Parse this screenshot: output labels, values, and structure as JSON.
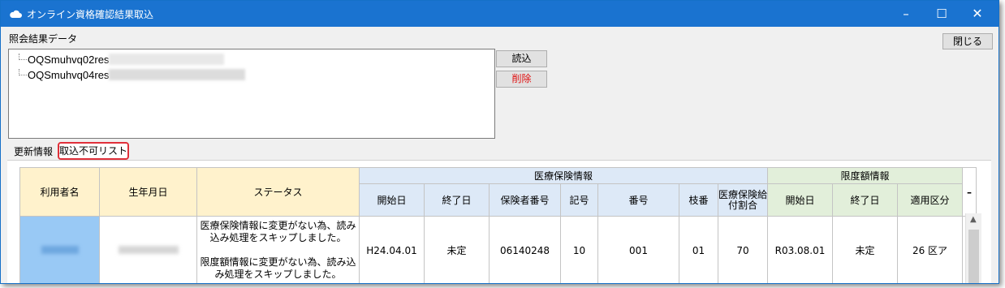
{
  "window": {
    "title": "オンライン資格確認結果取込",
    "controls": {
      "minimize": "–",
      "maximize": "☐",
      "close": "✕"
    }
  },
  "labels": {
    "result_data": "照会結果データ"
  },
  "buttons": {
    "close": "閉じる",
    "read": "読込",
    "delete": "削除"
  },
  "files": [
    {
      "name": "OQSmuhvq02res",
      "selected": false
    },
    {
      "name": "OQSmuhvq04res",
      "selected": true
    }
  ],
  "tabs": [
    {
      "label": "更新情報",
      "active": false
    },
    {
      "label": "取込不可リスト",
      "active": true
    }
  ],
  "table": {
    "groups": {
      "medical": "医療保険情報",
      "limit": "限度額情報"
    },
    "headers": {
      "user_name": "利用者名",
      "birthdate": "生年月日",
      "status": "ステータス",
      "med_start": "開始日",
      "med_end": "終了日",
      "insurer_number": "保険者番号",
      "symbol": "記号",
      "number": "番号",
      "branch": "枝番",
      "benefit_ratio": "医療保険給付割合",
      "limit_start": "開始日",
      "limit_end": "終了日",
      "applicable_class": "適用区分",
      "more": "–"
    },
    "rows": [
      {
        "status_lines": [
          "医療保険情報に変更がない為、読み込み処理をスキップしました。",
          "限度額情報に変更がない為、読み込み処理をスキップしました。"
        ],
        "med_start": "H24.04.01",
        "med_end": "未定",
        "insurer_number": "06140248",
        "symbol": "10",
        "number": "001",
        "branch": "01",
        "benefit_ratio": "70",
        "limit_start": "R03.08.01",
        "limit_end": "未定",
        "applicable_class": "26 区ア"
      }
    ]
  },
  "colors": {
    "titlebar": "#1a73d0",
    "header_yellow": "#fff2cc",
    "header_blue": "#dde9f7",
    "header_green": "#e2efda",
    "selected_cell": "#99c9f5",
    "delete_text": "#e01010",
    "tab_highlight": "#e0303a"
  }
}
